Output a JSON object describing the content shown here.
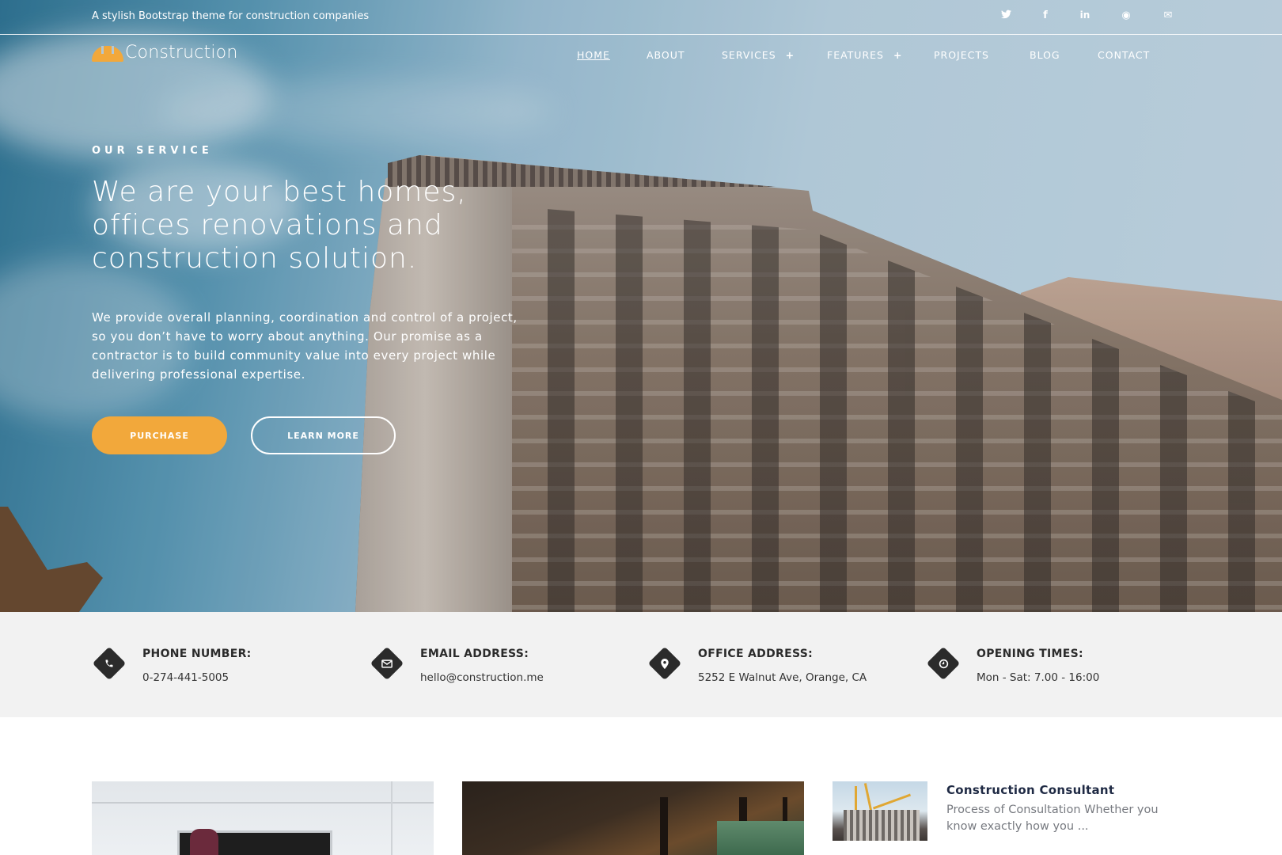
{
  "topbar": {
    "tagline": "A stylish Bootstrap theme for construction companies",
    "social": [
      {
        "icon": "twitter-icon",
        "glyph": "🐦"
      },
      {
        "icon": "facebook-icon",
        "glyph": "f"
      },
      {
        "icon": "linkedin-icon",
        "glyph": "in"
      },
      {
        "icon": "dribbble-icon",
        "glyph": "◉"
      },
      {
        "icon": "email-icon",
        "glyph": "✉"
      }
    ]
  },
  "brand": {
    "name": "Construction",
    "accent": "#f2a83b"
  },
  "nav": {
    "items": [
      {
        "label": "HOME",
        "active": true,
        "has_submenu": false
      },
      {
        "label": "ABOUT",
        "active": false,
        "has_submenu": false
      },
      {
        "label": "SERVICES",
        "active": false,
        "has_submenu": true
      },
      {
        "label": "FEATURES",
        "active": false,
        "has_submenu": true
      },
      {
        "label": "PROJECTS",
        "active": false,
        "has_submenu": false
      },
      {
        "label": "BLOG",
        "active": false,
        "has_submenu": false
      },
      {
        "label": "CONTACT",
        "active": false,
        "has_submenu": false
      }
    ],
    "submenu_glyph": "+"
  },
  "hero": {
    "eyebrow": "OUR SERVICE",
    "headline": "We are your best homes, offices renovations and construction solution.",
    "lead": "We provide overall planning, coordination and control of a project, so you don’t have to worry about anything. Our promise as a contractor is to build community value into every project while delivering professional expertise.",
    "buttons": {
      "purchase": "PURCHASE",
      "learn_more": "LEARN MORE"
    }
  },
  "info": {
    "items": [
      {
        "icon": "phone-icon",
        "glyph": "✆",
        "label": "PHONE NUMBER:",
        "value": "0-274-441-5005"
      },
      {
        "icon": "envelope-icon",
        "glyph": "✉",
        "label": "EMAIL ADDRESS:",
        "value": "hello@construction.me"
      },
      {
        "icon": "map-pin-icon",
        "glyph": "⬤",
        "label": "OFFICE ADDRESS:",
        "value": "5252 E Walnut Ave, Orange, CA"
      },
      {
        "icon": "clock-icon",
        "glyph": "◷",
        "label": "OPENING TIMES:",
        "value": "Mon - Sat: 7.00 - 16:00"
      }
    ]
  },
  "services": {
    "featured": {
      "title": "Construction Consultant",
      "excerpt": "Process of Consultation Whether you know exactly how you ..."
    }
  }
}
